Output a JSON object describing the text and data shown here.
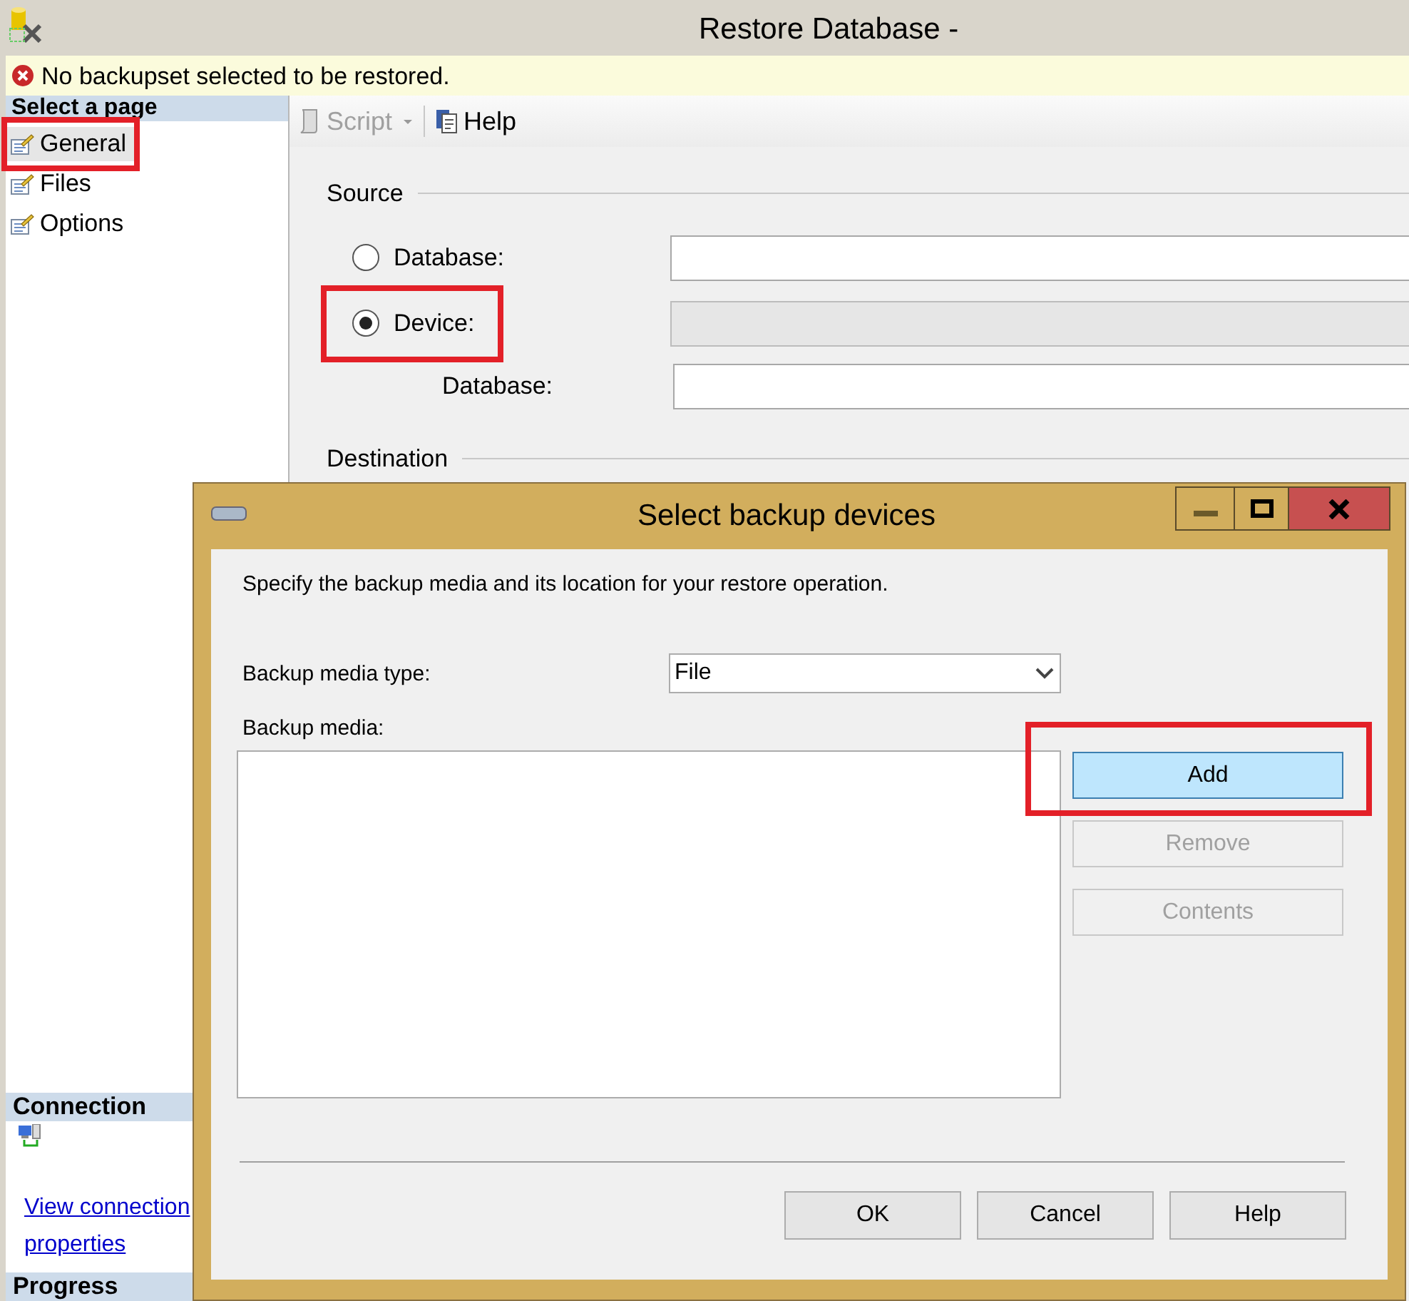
{
  "window": {
    "title": "Restore Database -"
  },
  "message": {
    "kind": "error",
    "text": "No backupset selected to be restored."
  },
  "sidebar": {
    "header": "Select a page",
    "items": [
      {
        "label": "General",
        "selected": true,
        "highlighted": true
      },
      {
        "label": "Files",
        "selected": false,
        "highlighted": false
      },
      {
        "label": "Options",
        "selected": false,
        "highlighted": false
      }
    ],
    "connection": {
      "header": "Connection",
      "link": "View connection properties"
    },
    "progress": {
      "header": "Progress"
    }
  },
  "toolbar": {
    "buttons": [
      {
        "kind": "script",
        "label": "Script",
        "disabled": true,
        "dropdown": true
      },
      {
        "kind": "help",
        "label": "Help",
        "disabled": false,
        "dropdown": false
      }
    ]
  },
  "source": {
    "title": "Source",
    "options": [
      {
        "label": "Database:",
        "selected": false,
        "highlighted": false,
        "field_disabled": false
      },
      {
        "label": "Device:",
        "selected": true,
        "highlighted": true,
        "field_disabled": true
      }
    ],
    "database_label": "Database:"
  },
  "destination": {
    "title": "Destination"
  },
  "dialog": {
    "title": "Select backup devices",
    "description": "Specify the backup media and its location for your restore operation.",
    "media_type_label": "Backup media type:",
    "media_type_value": "File",
    "media_label": "Backup media:",
    "side_buttons": [
      {
        "label": "Add",
        "hot": true,
        "disabled": false,
        "highlighted": true
      },
      {
        "label": "Remove",
        "hot": false,
        "disabled": true,
        "highlighted": false
      },
      {
        "label": "Contents",
        "hot": false,
        "disabled": true,
        "highlighted": false
      }
    ],
    "buttons": [
      {
        "label": "OK"
      },
      {
        "label": "Cancel"
      },
      {
        "label": "Help"
      }
    ]
  }
}
